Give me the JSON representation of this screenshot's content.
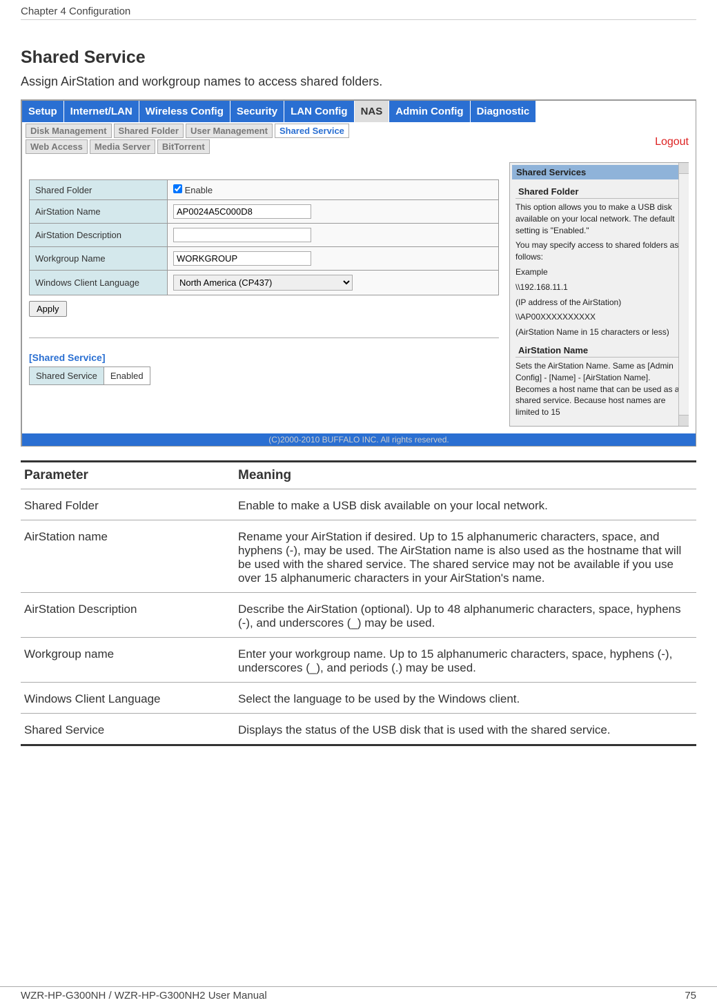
{
  "chapter": "Chapter 4  Configuration",
  "sectionTitle": "Shared Service",
  "intro": "Assign AirStation and workgroup names to access shared folders.",
  "mainTabs": [
    {
      "label": "Setup",
      "active": false
    },
    {
      "label": "Internet/LAN",
      "active": false
    },
    {
      "label": "Wireless Config",
      "active": false
    },
    {
      "label": "Security",
      "active": false
    },
    {
      "label": "LAN Config",
      "active": false
    },
    {
      "label": "NAS",
      "active": true
    },
    {
      "label": "Admin Config",
      "active": false
    },
    {
      "label": "Diagnostic",
      "active": false
    }
  ],
  "subTabs1": [
    {
      "label": "Disk Management",
      "active": false
    },
    {
      "label": "Shared Folder",
      "active": false
    },
    {
      "label": "User Management",
      "active": false
    },
    {
      "label": "Shared Service",
      "active": true
    }
  ],
  "subTabs2": [
    {
      "label": "Web Access",
      "active": false
    },
    {
      "label": "Media Server",
      "active": false
    },
    {
      "label": "BitTorrent",
      "active": false
    }
  ],
  "logoutLabel": "Logout",
  "form": {
    "sharedFolderLabel": "Shared Folder",
    "sharedFolderEnable": "Enable",
    "airstationNameLabel": "AirStation Name",
    "airstationNameValue": "AP0024A5C000D8",
    "airstationDescLabel": "AirStation Description",
    "airstationDescValue": "",
    "workgroupLabel": "Workgroup Name",
    "workgroupValue": "WORKGROUP",
    "winClientLabel": "Windows Client Language",
    "winClientValue": "North America (CP437)",
    "applyLabel": "Apply"
  },
  "sharedServiceHeading": "[Shared Service]",
  "sharedServiceStatusLabel": "Shared Service",
  "sharedServiceStatusValue": "Enabled",
  "help": {
    "title": "Shared Services",
    "h1": "Shared Folder",
    "p1": "This option allows you to make a USB disk available on your local network. The default setting is \"Enabled.\"",
    "p2": "You may specify access to shared folders as follows:",
    "p3": "Example",
    "p4": "\\\\192.168.11.1",
    "p5": "(IP address of the AirStation)",
    "p6": "\\\\AP00XXXXXXXXXX",
    "p7": "(AirStation Name in 15 characters or less)",
    "h2": "AirStation Name",
    "p8": "Sets the AirStation Name. Same as [Admin Config] - [Name] - [AirStation Name]. Becomes a host name that can be used as a shared service. Because host names are limited to 15"
  },
  "copyright": "(C)2000-2010 BUFFALO INC. All rights reserved.",
  "paramTable": {
    "headerParam": "Parameter",
    "headerMeaning": "Meaning",
    "rows": [
      {
        "param": "Shared Folder",
        "meaning": "Enable to make a USB disk available on your local network."
      },
      {
        "param": "AirStation name",
        "meaning": "Rename your AirStation if desired.  Up to 15 alphanumeric characters, space, and hyphens (-), may be used.  The AirStation name is also used as the hostname that will be used with the shared service. The shared service may not be available if you use over 15 alphanumeric characters in your AirStation's name."
      },
      {
        "param": "AirStation Description",
        "meaning": "Describe the AirStation (optional).  Up to 48 alphanumeric characters, space, hyphens (-), and underscores (_) may be used."
      },
      {
        "param": "Workgroup name",
        "meaning": "Enter your workgroup name.  Up to 15 alphanumeric characters, space, hyphens (-), underscores (_), and periods (.) may be used."
      },
      {
        "param": "Windows Client Language",
        "meaning": "Select the language to be used by the Windows client."
      },
      {
        "param": "Shared Service",
        "meaning": "Displays the status of the USB disk that is used with the shared service."
      }
    ]
  },
  "footer": {
    "left": "WZR-HP-G300NH / WZR-HP-G300NH2 User Manual",
    "right": "75"
  }
}
